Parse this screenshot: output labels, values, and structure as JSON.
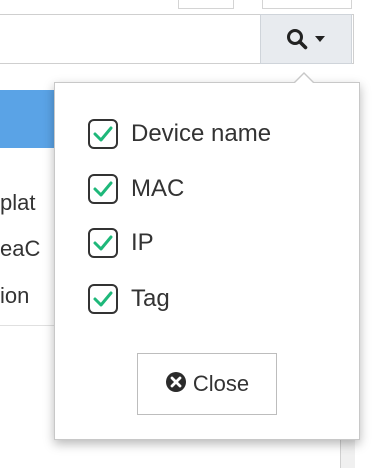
{
  "search_button": {
    "icon": "search-icon",
    "dropdown_icon": "caret-down-icon"
  },
  "background": {
    "partial_rows": [
      "plat",
      "eaC",
      "ion"
    ],
    "highlight_color": "#5aa3e6"
  },
  "popover": {
    "options": [
      {
        "label": "Device name",
        "checked": true
      },
      {
        "label": "MAC",
        "checked": true
      },
      {
        "label": "IP",
        "checked": true
      },
      {
        "label": "Tag",
        "checked": true
      }
    ],
    "close_button": {
      "label": "Close",
      "icon": "times-circle-icon"
    }
  },
  "colors": {
    "checkmark": "#1eb87a",
    "text": "#333333",
    "button_bg": "#e8ebef"
  }
}
